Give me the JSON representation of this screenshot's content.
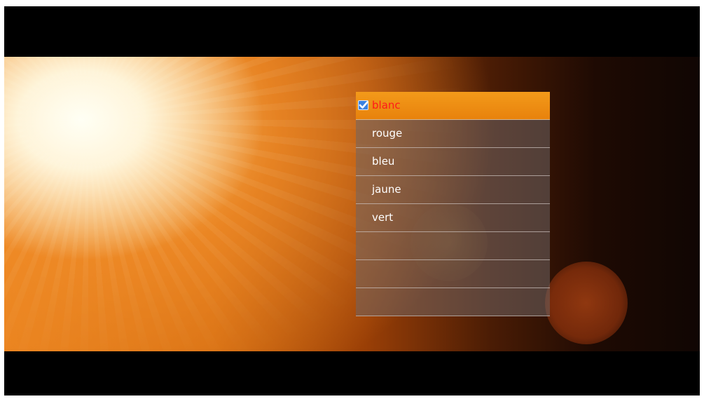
{
  "menu": {
    "items": [
      {
        "label": "blanc",
        "selected": true
      },
      {
        "label": "rouge",
        "selected": false
      },
      {
        "label": "bleu",
        "selected": false
      },
      {
        "label": "jaune",
        "selected": false
      },
      {
        "label": "vert",
        "selected": false
      },
      {
        "label": "",
        "selected": false
      },
      {
        "label": "",
        "selected": false
      },
      {
        "label": "",
        "selected": false
      }
    ]
  },
  "icons": {
    "selected_marker": "checkbox-checked-icon"
  },
  "colors": {
    "selected_row_bg": "#e8820c",
    "selected_text": "#ff1a1a",
    "row_text": "#ffffff",
    "check_bg": "#3b82e0"
  }
}
